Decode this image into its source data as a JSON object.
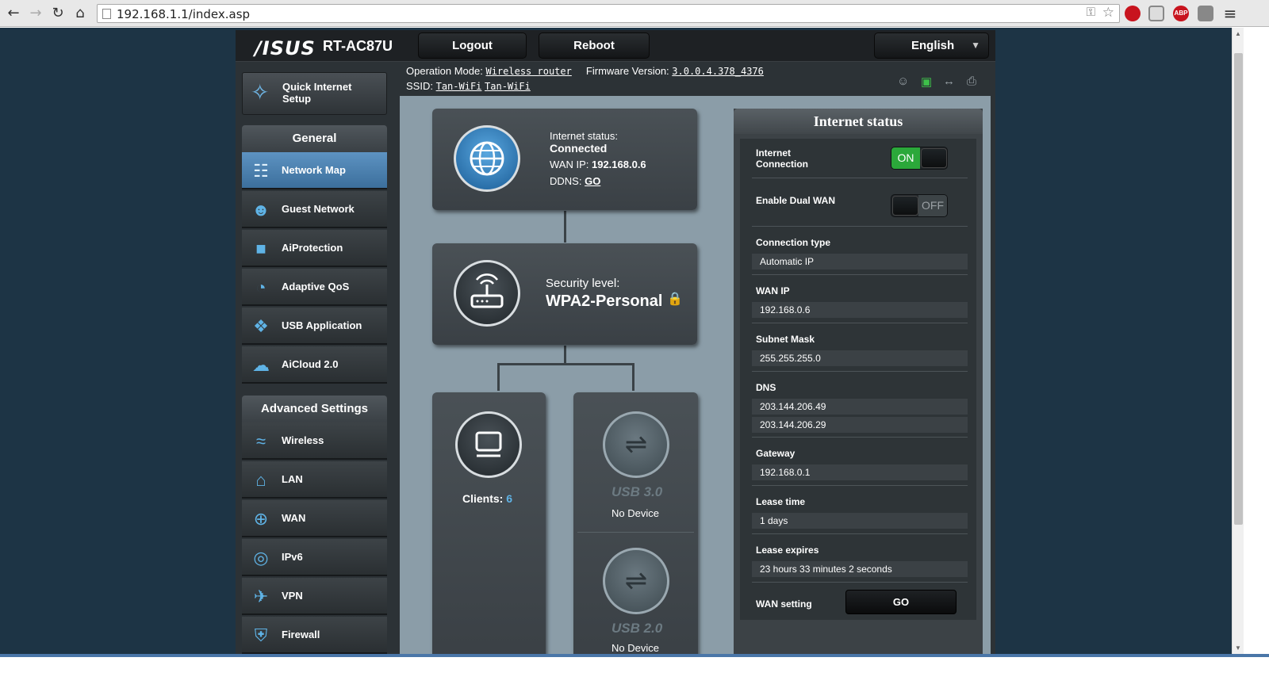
{
  "browser": {
    "url": "192.168.1.1/index.asp",
    "back_icon": "←",
    "forward_icon": "→",
    "reload_icon": "↻",
    "home_icon": "⌂",
    "star_icon": "☆",
    "abp_label": "ABP",
    "menu_icon": "≡"
  },
  "header": {
    "brand": "/ISUS",
    "model": "RT-AC87U",
    "logout_label": "Logout",
    "reboot_label": "Reboot",
    "language": "English"
  },
  "info": {
    "op_mode_label": "Operation Mode:",
    "op_mode_value": "Wireless router",
    "fw_label": "Firmware Version:",
    "fw_value": "3.0.0.4.378_4376",
    "ssid_label": "SSID:",
    "ssid_1": "Tan-WiFi",
    "ssid_2": "Tan-WiFi"
  },
  "sidebar": {
    "qis_label": "Quick Internet Setup",
    "general_header": "General",
    "general_items": [
      {
        "label": "Network Map",
        "icon": "network-map-icon",
        "active": true
      },
      {
        "label": "Guest Network",
        "icon": "guest-network-icon"
      },
      {
        "label": "AiProtection",
        "icon": "lock-icon"
      },
      {
        "label": "Adaptive QoS",
        "icon": "speedometer-icon"
      },
      {
        "label": "USB Application",
        "icon": "puzzle-icon"
      },
      {
        "label": "AiCloud 2.0",
        "icon": "cloud-icon"
      }
    ],
    "advanced_header": "Advanced Settings",
    "advanced_items": [
      {
        "label": "Wireless",
        "icon": "wifi-icon"
      },
      {
        "label": "LAN",
        "icon": "home-icon"
      },
      {
        "label": "WAN",
        "icon": "globe-icon"
      },
      {
        "label": "IPv6",
        "icon": "ipv6-icon"
      },
      {
        "label": "VPN",
        "icon": "vpn-icon"
      },
      {
        "label": "Firewall",
        "icon": "shield-icon"
      }
    ]
  },
  "network_map": {
    "internet_status_label": "Internet status:",
    "internet_status_value": "Connected",
    "wan_ip_label": "WAN IP:",
    "wan_ip_value": "192.168.0.6",
    "ddns_label": "DDNS:",
    "ddns_link": "GO",
    "security_label": "Security level:",
    "security_value": "WPA2-Personal",
    "clients_label": "Clients:",
    "clients_count": "6",
    "usb3_label": "USB 3.0",
    "usb3_status": "No Device",
    "usb2_label": "USB 2.0",
    "usb2_status": "No Device"
  },
  "internet_status": {
    "title": "Internet status",
    "internet_connection_label": "Internet Connection",
    "internet_connection_state": "ON",
    "dual_wan_label": "Enable Dual WAN",
    "dual_wan_state": "OFF",
    "connection_type_label": "Connection type",
    "connection_type_value": "Automatic IP",
    "wan_ip_label": "WAN IP",
    "wan_ip_value": "192.168.0.6",
    "subnet_label": "Subnet Mask",
    "subnet_value": "255.255.255.0",
    "dns_label": "DNS",
    "dns_1": "203.144.206.49",
    "dns_2": "203.144.206.29",
    "gateway_label": "Gateway",
    "gateway_value": "192.168.0.1",
    "lease_time_label": "Lease time",
    "lease_time_value": "1 days",
    "lease_expires_label": "Lease expires",
    "lease_expires_value": "23 hours 33 minutes 2 seconds",
    "wan_setting_label": "WAN setting",
    "wan_setting_button": "GO"
  },
  "colors": {
    "accent_blue": "#5fb3e6",
    "on_green": "#2ba83a",
    "page_bg": "#1d3445"
  }
}
